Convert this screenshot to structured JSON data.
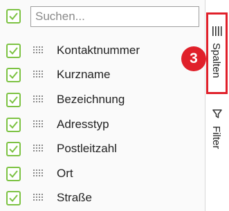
{
  "search": {
    "placeholder": "Suchen...",
    "value": ""
  },
  "columns": [
    {
      "label": "Kontaktnummer",
      "checked": true
    },
    {
      "label": "Kurzname",
      "checked": true
    },
    {
      "label": "Bezeichnung",
      "checked": true
    },
    {
      "label": "Adresstyp",
      "checked": true
    },
    {
      "label": "Postleitzahl",
      "checked": true
    },
    {
      "label": "Ort",
      "checked": true
    },
    {
      "label": "Straße",
      "checked": true
    }
  ],
  "sidebar": {
    "tabs": [
      {
        "label": "Spalten",
        "icon": "columns-icon",
        "active": true
      },
      {
        "label": "Filter",
        "icon": "filter-icon",
        "active": false
      }
    ]
  },
  "annotation": {
    "step_number": "3",
    "color": "#e0202a"
  },
  "colors": {
    "check_accent": "#7cc242",
    "highlight": "#e0202a"
  }
}
